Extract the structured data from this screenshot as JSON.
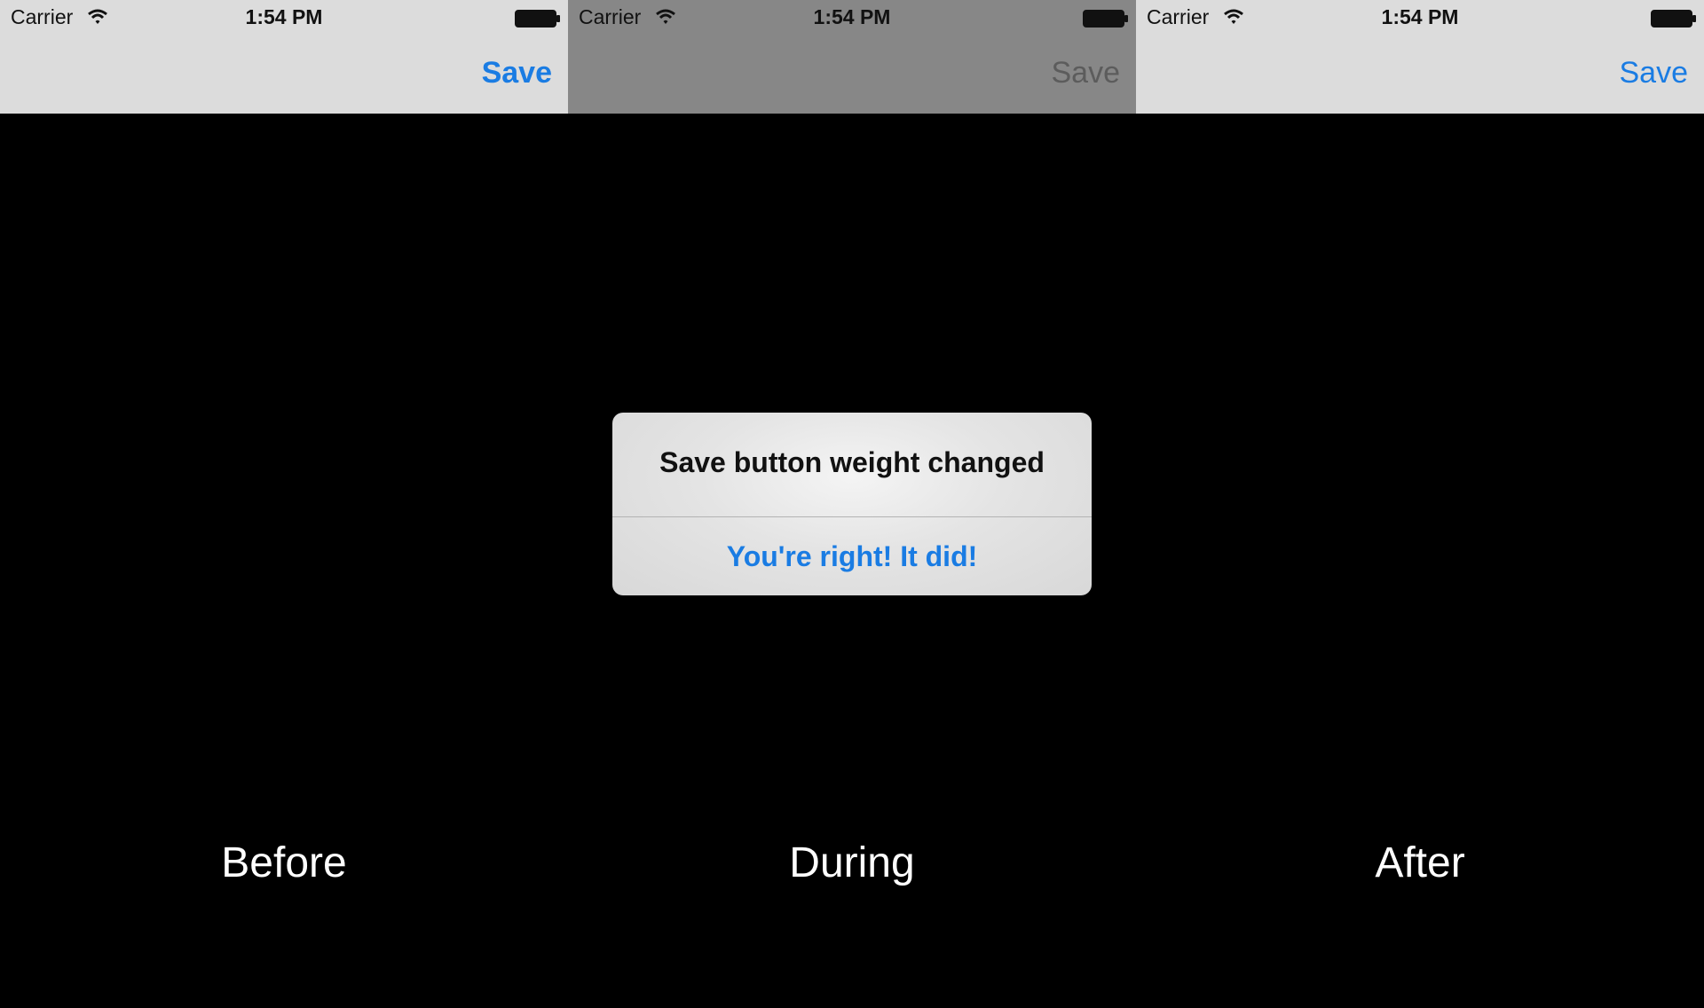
{
  "colors": {
    "nav_bar_bg": "#dcdcdc",
    "nav_bar_dimmed_bg": "#878787",
    "tint_blue": "#1a7ce3",
    "dimmed_button_text": "#5c5c5c",
    "background": "#000000"
  },
  "panels": [
    {
      "status_bar": {
        "carrier": "Carrier",
        "time": "1:54 PM",
        "wifi_icon": "wifi-icon",
        "battery_icon": "battery-icon"
      },
      "nav_bar": {
        "right_button": "Save",
        "button_weight": "bold"
      },
      "caption": "Before"
    },
    {
      "status_bar": {
        "carrier": "Carrier",
        "time": "1:54 PM",
        "wifi_icon": "wifi-icon",
        "battery_icon": "battery-icon"
      },
      "nav_bar": {
        "right_button": "Save",
        "button_weight": "regular",
        "dimmed": true
      },
      "alert": {
        "title": "Save button weight changed",
        "button": "You're right! It did!"
      },
      "caption": "During"
    },
    {
      "status_bar": {
        "carrier": "Carrier",
        "time": "1:54 PM",
        "wifi_icon": "wifi-icon",
        "battery_icon": "battery-icon"
      },
      "nav_bar": {
        "right_button": "Save",
        "button_weight": "regular"
      },
      "caption": "After"
    }
  ]
}
